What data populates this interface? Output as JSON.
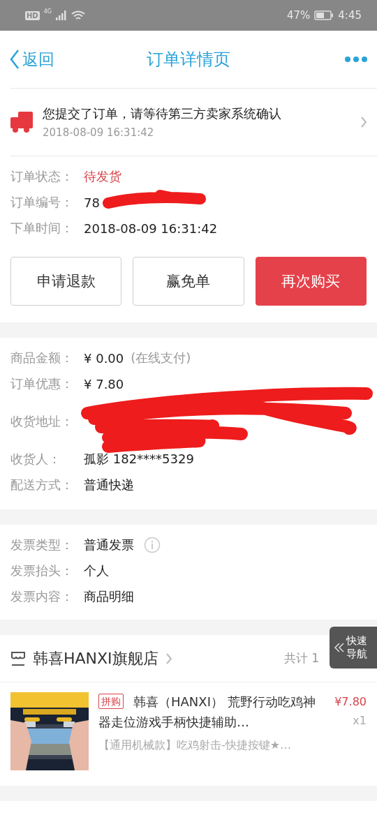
{
  "status_bar": {
    "hd": "HD",
    "network": "4G",
    "battery": "47%",
    "time": "4:45"
  },
  "nav": {
    "back": "返回",
    "title": "订单详情页"
  },
  "notice": {
    "message": "您提交了订单，请等待第三方卖家系统确认",
    "time": "2018-08-09 16:31:42"
  },
  "order_info": [
    {
      "label": "订单状态：",
      "value": "待发货",
      "kind": "status"
    },
    {
      "label": "订单编号：",
      "value": "78",
      "kind": "redacted"
    },
    {
      "label": "下单时间：",
      "value": "2018-08-09 16:31:42",
      "kind": "plain"
    }
  ],
  "actions": [
    {
      "label": "申请退款",
      "primary": false
    },
    {
      "label": "赢免单",
      "primary": false
    },
    {
      "label": "再次购买",
      "primary": true
    }
  ],
  "payment": [
    {
      "label": "商品金额：",
      "value": "¥ 0.00",
      "note": "(在线支付)",
      "kind": "plain"
    },
    {
      "label": "订单优惠：",
      "value": "¥ 7.80",
      "kind": "plain"
    },
    {
      "label": "收货地址：",
      "kind": "redacted"
    },
    {
      "label": "收货人：",
      "value": "孤影 182****5329",
      "kind": "plain"
    },
    {
      "label": "配送方式：",
      "value": "普通快递",
      "kind": "plain"
    }
  ],
  "invoice": [
    {
      "label": "发票类型：",
      "value": "普通发票",
      "info": true
    },
    {
      "label": "发票抬头：",
      "value": "个人",
      "info": false
    },
    {
      "label": "发票内容：",
      "value": "商品明细",
      "info": false
    }
  ],
  "shop": {
    "name": "韩喜HANXI旗舰店",
    "count": "共计 1"
  },
  "quick_nav": {
    "label": "快速导航"
  },
  "product": {
    "kind": "picture",
    "tag": "拼购",
    "title": "韩喜（HANXI） 荒野行动吃鸡神器走位游戏手柄快捷辅助…",
    "spec": "【通用机械款】吃鸡射击-快捷按键★…",
    "price": "¥7.80",
    "quantity": "x1"
  }
}
